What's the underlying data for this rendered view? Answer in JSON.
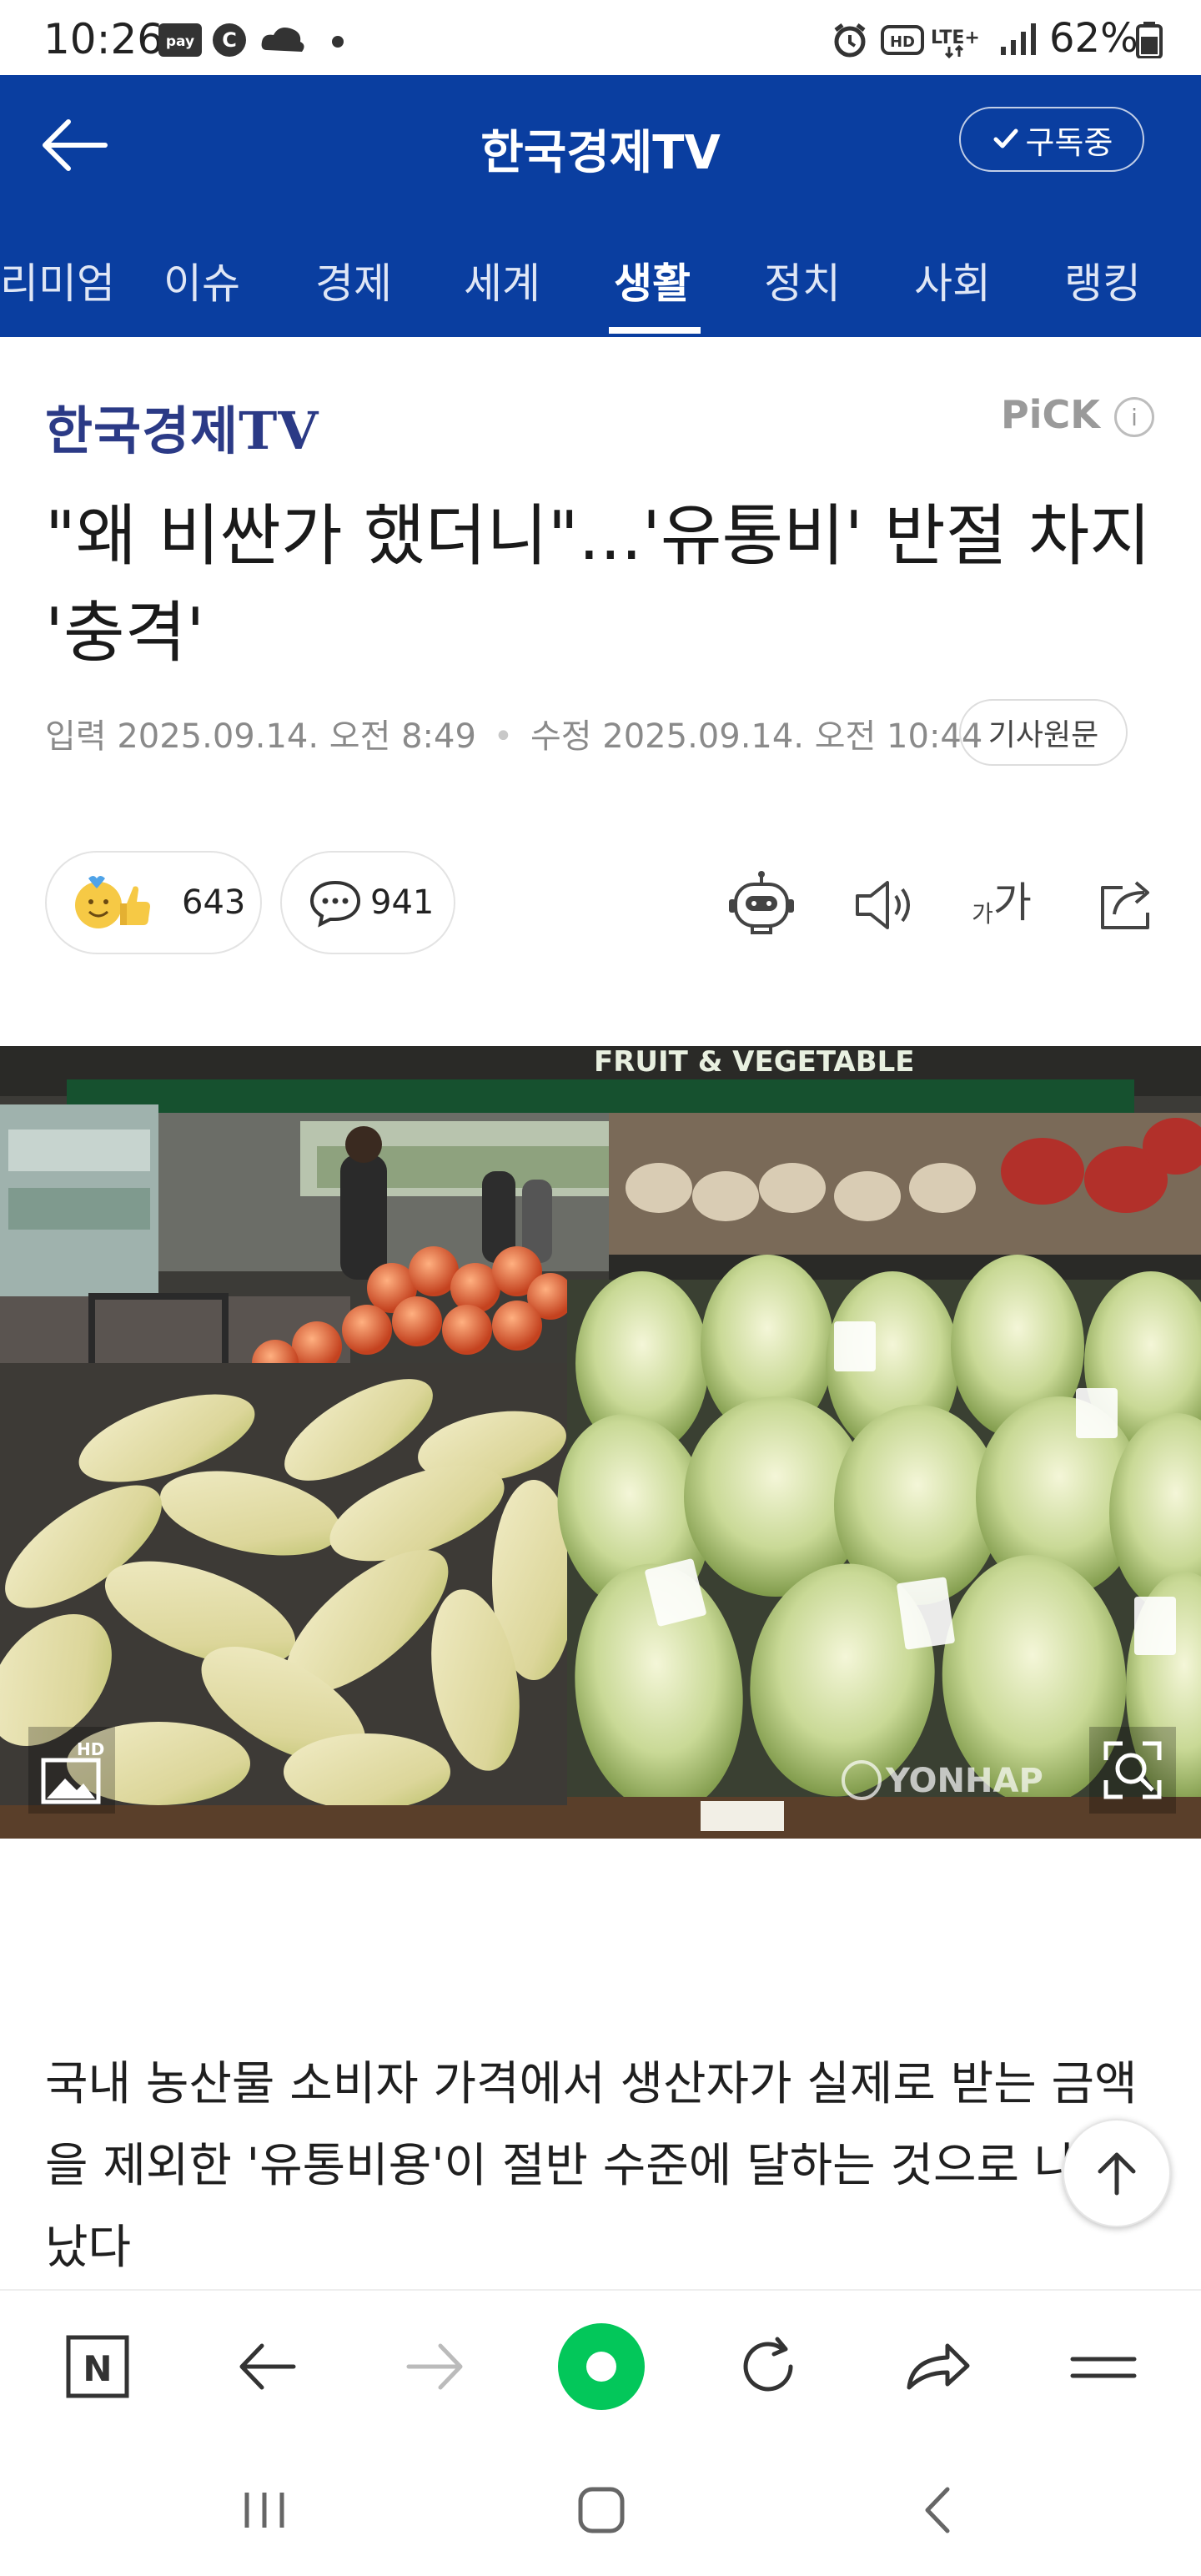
{
  "status_bar": {
    "time": "10:26",
    "battery": "62%",
    "icons": [
      "pay-icon",
      "c-icon",
      "cloud-icon",
      "dot-icon",
      "alarm-icon",
      "hd-icon",
      "lte-icon",
      "signal-icon",
      "battery-icon"
    ],
    "pay_label": "pay",
    "hd_label": "HD",
    "lte_label": "LTE+"
  },
  "header": {
    "title": "한국경제TV",
    "subscribe_label": "구독중"
  },
  "tabs": [
    {
      "label": "프리미엄"
    },
    {
      "label": "이슈"
    },
    {
      "label": "경제"
    },
    {
      "label": "세계"
    },
    {
      "label": "생활"
    },
    {
      "label": "정치"
    },
    {
      "label": "사회"
    },
    {
      "label": "랭킹"
    }
  ],
  "article": {
    "press": "한국경제TV",
    "pick": "PiCK",
    "pick_info": "i",
    "headline": "\"왜 비싼가 했더니\"...'유통비' 반절 차지 '충격'",
    "input_label": "입력",
    "input_date": "2025.09.14. 오전 8:49",
    "modified_label": "수정",
    "modified_date": "2025.09.14. 오전 10:44",
    "original_button": "기사원문",
    "reaction_count": "643",
    "comment_count": "941",
    "font_label_small": "가",
    "font_label_large": "가",
    "photo_badge": "HD",
    "photo_watermark": "YONHAP",
    "photo_sign": "FRUIT & VEGETABLE",
    "body": "국내 농산물 소비자 가격에서 생산자가 실제로 받는 금액을 제외한 '유통비용'이 절반 수준에 달하는 것으로 나타났다"
  },
  "colors": {
    "brand_blue": "#0a3ea0",
    "press_logo": "#2b3a86",
    "naver_green": "#03c75a"
  }
}
